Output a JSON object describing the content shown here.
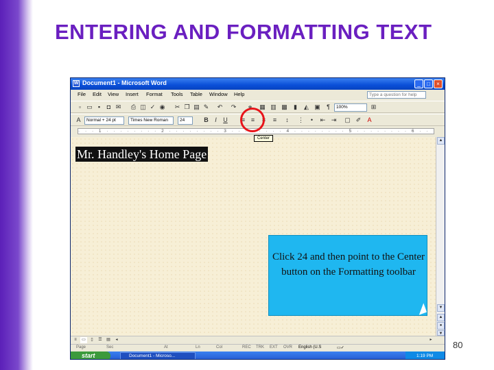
{
  "slide": {
    "title": "ENTERING AND FORMATTING TEXT",
    "page_number": "80"
  },
  "window": {
    "title": "Document1 - Microsoft Word",
    "menus": [
      "File",
      "Edit",
      "View",
      "Insert",
      "Format",
      "Tools",
      "Table",
      "Window",
      "Help"
    ],
    "help_placeholder": "Type a question for help"
  },
  "toolbar": {
    "zoom": "100%",
    "style": "Normal + 24 pt",
    "font": "Times New Roman",
    "size": "24"
  },
  "document": {
    "heading": "Mr. Handley's Home Page",
    "tooltip": "Center"
  },
  "callout": {
    "text": "Click 24 and then point to the Center button on the Formatting toolbar"
  },
  "statusbar": {
    "items": [
      "Page",
      "Sec",
      "At",
      "Ln",
      "Col",
      "REC",
      "TRK",
      "EXT",
      "OVR",
      "English (U.S"
    ]
  },
  "taskbar": {
    "start_label": "start",
    "task_label": "Document1 - Microso...",
    "clock": "1:19 PM"
  },
  "colors": {
    "title": "#6a1fc0",
    "callout": "#1fb7f0",
    "highlight_circle": "#e8141a"
  }
}
